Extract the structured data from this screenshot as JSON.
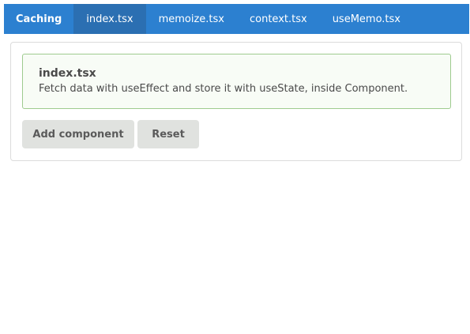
{
  "navbar": {
    "brand": "Caching",
    "tabs": [
      {
        "label": "index.tsx",
        "active": true
      },
      {
        "label": "memoize.tsx",
        "active": false
      },
      {
        "label": "context.tsx",
        "active": false
      },
      {
        "label": "useMemo.tsx",
        "active": false
      }
    ],
    "colors": {
      "background": "#2c80d0",
      "active_tab": "#2b6fb2"
    }
  },
  "alert": {
    "title": "index.tsx",
    "text": "Fetch data with useEffect and store it with useState, inside Component."
  },
  "buttons": {
    "add_label": "Add component",
    "reset_label": "Reset"
  }
}
